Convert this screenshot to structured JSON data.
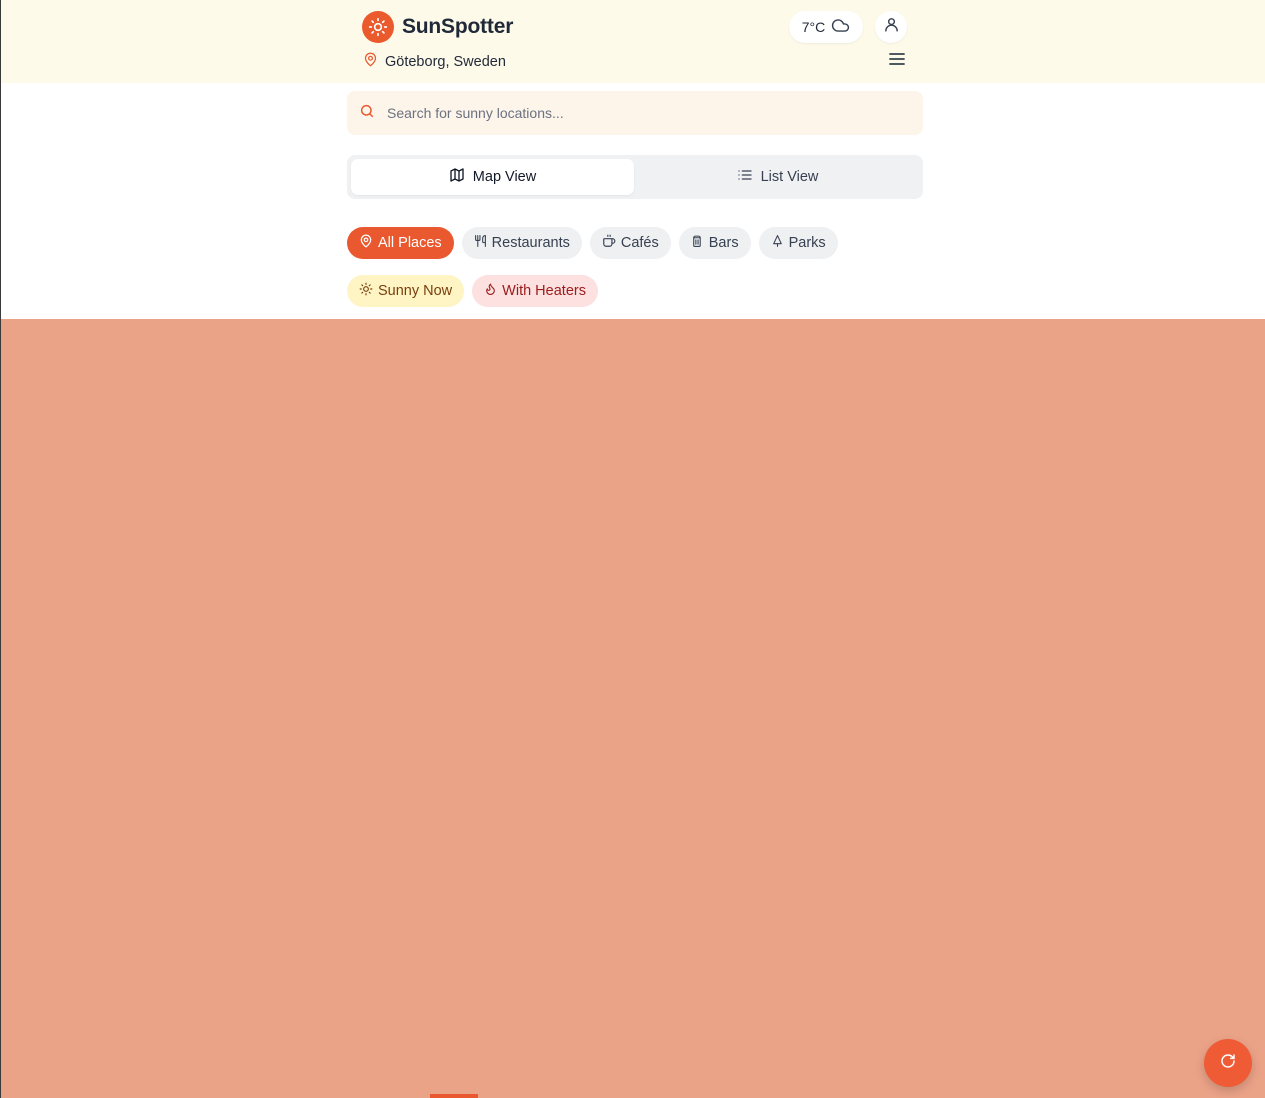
{
  "app": {
    "name": "SunSpotter",
    "location": "Göteborg, Sweden",
    "temperature": "7°C",
    "weather_icon": "cloud-icon",
    "accent_color": "#e9582e"
  },
  "search": {
    "placeholder": "Search for sunny locations..."
  },
  "view_toggle": {
    "tabs": [
      {
        "label": "Map View",
        "icon": "map-icon",
        "active": true
      },
      {
        "label": "List View",
        "icon": "list-icon",
        "active": false
      }
    ]
  },
  "categories": [
    {
      "label": "All Places",
      "icon": "map-pin-icon",
      "active": true
    },
    {
      "label": "Restaurants",
      "icon": "utensils-icon",
      "active": false
    },
    {
      "label": "Cafés",
      "icon": "coffee-icon",
      "active": false
    },
    {
      "label": "Bars",
      "icon": "beer-icon",
      "active": false
    },
    {
      "label": "Parks",
      "icon": "tree-icon",
      "active": false
    }
  ],
  "filters": [
    {
      "label": "Sunny Now",
      "icon": "sun-icon"
    },
    {
      "label": "With Heaters",
      "icon": "flame-icon"
    }
  ],
  "map": {
    "background_color": "#eba388"
  },
  "fab": {
    "icon": "refresh-icon"
  }
}
